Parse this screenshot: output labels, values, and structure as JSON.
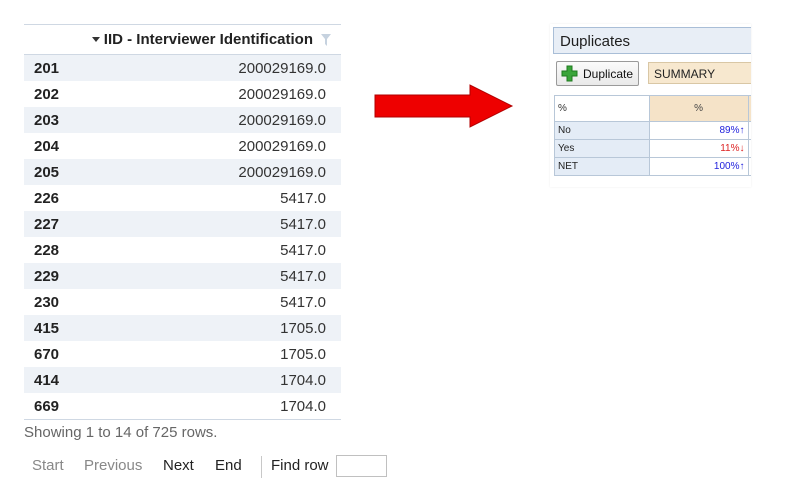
{
  "table": {
    "column_header": "IID - Interviewer Identification",
    "rows": [
      {
        "id": "201",
        "value": "200029169.0"
      },
      {
        "id": "202",
        "value": "200029169.0"
      },
      {
        "id": "203",
        "value": "200029169.0"
      },
      {
        "id": "204",
        "value": "200029169.0"
      },
      {
        "id": "205",
        "value": "200029169.0"
      },
      {
        "id": "226",
        "value": "5417.0"
      },
      {
        "id": "227",
        "value": "5417.0"
      },
      {
        "id": "228",
        "value": "5417.0"
      },
      {
        "id": "229",
        "value": "5417.0"
      },
      {
        "id": "230",
        "value": "5417.0"
      },
      {
        "id": "415",
        "value": "1705.0"
      },
      {
        "id": "670",
        "value": "1705.0"
      },
      {
        "id": "414",
        "value": "1704.0"
      },
      {
        "id": "669",
        "value": "1704.0"
      }
    ],
    "showing_text": "Showing 1 to 14 of 725 rows."
  },
  "pager": {
    "start": "Start",
    "previous": "Previous",
    "next": "Next",
    "end": "End",
    "find_row": "Find row",
    "find_value": ""
  },
  "panel": {
    "title": "Duplicates",
    "duplicate_button": "Duplicate",
    "summary": "SUMMARY",
    "header_left": "%",
    "header_right": "%",
    "rows": [
      {
        "label": "No",
        "value": "89%",
        "arrow": "↑",
        "direction": "up"
      },
      {
        "label": "Yes",
        "value": "11%",
        "arrow": "↓",
        "direction": "down"
      },
      {
        "label": "NET",
        "value": "100%",
        "arrow": "↑",
        "direction": "up"
      }
    ]
  },
  "icons": {
    "sort": "sort-desc-icon",
    "filter": "filter-icon",
    "arrow": "red-right-arrow-icon",
    "plus": "green-plus-icon"
  },
  "colors": {
    "arrow": "#ee0000",
    "row_stripe": "#eef2f7",
    "up": "#2222dd",
    "down": "#dd2222",
    "plus": "#3aa53a"
  }
}
